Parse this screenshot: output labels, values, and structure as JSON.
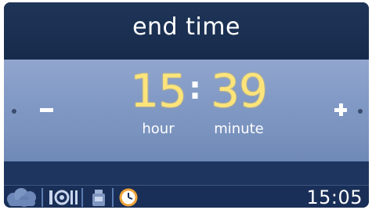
{
  "header": {
    "title": "end time"
  },
  "time_setting": {
    "hour_value": "15",
    "hour_label": "hour",
    "separator": ":",
    "minute_value": "39",
    "minute_label": "minute"
  },
  "controls": {
    "decrease_icon": "minus-icon",
    "increase_icon": "plus-icon"
  },
  "bottom_bar": {
    "icons": [
      "steam-cloud-icon",
      "oven-heat-icon",
      "weight-jar-icon",
      "timer-clock-icon"
    ],
    "clock": "15:05"
  },
  "colors": {
    "accent_digits": "#fde47a",
    "panel": "#839bc6",
    "background": "#0d1b33"
  }
}
